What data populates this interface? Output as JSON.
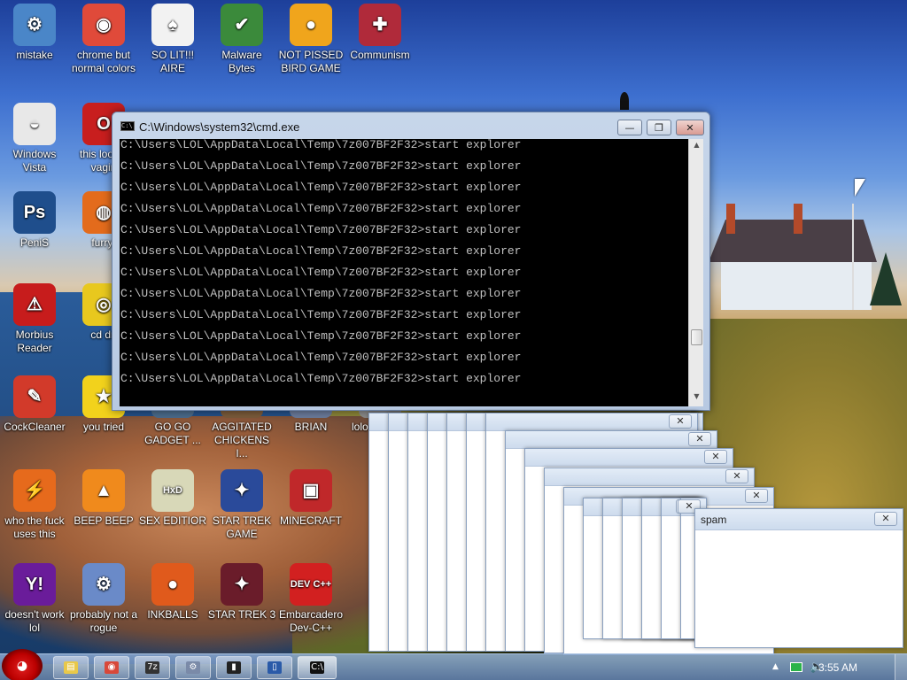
{
  "desktop": {
    "icons": [
      {
        "label": "mistake",
        "glyph": "⚙",
        "color": "#4a86c8"
      },
      {
        "label": "chrome but normal colors",
        "glyph": "◉",
        "color": "#e04a3a"
      },
      {
        "label": "SO LIT!!! AIRE",
        "glyph": "♠",
        "color": "#f2f2f2"
      },
      {
        "label": "Malware Bytes",
        "glyph": "✔",
        "color": "#3b8a3b"
      },
      {
        "label": "NOT PISSED BIRD GAME",
        "glyph": "●",
        "color": "#f0a51c"
      },
      {
        "label": "Communism",
        "glyph": "✚",
        "color": "#b02a3a"
      },
      {
        "label": "Windows Vista",
        "glyph": "◒",
        "color": "#e8e8e8"
      },
      {
        "label": "this look a vagin",
        "glyph": "O",
        "color": "#c81e1e"
      },
      {
        "label": "PeniS",
        "glyph": "Ps",
        "color": "#1f4e8c"
      },
      {
        "label": "furryf",
        "glyph": "◍",
        "color": "#e36b1c"
      },
      {
        "label": "Morbius Reader",
        "glyph": "⚠",
        "color": "#c71c1c"
      },
      {
        "label": "cd dri",
        "glyph": "◎",
        "color": "#e8c81e"
      },
      {
        "label": "CockCleaner",
        "glyph": "✎",
        "color": "#d23a2a"
      },
      {
        "label": "you tried",
        "glyph": "★",
        "color": "#f2d21c"
      },
      {
        "label": "GO GO GADGET ...",
        "glyph": "",
        "color": "#4a6a8a"
      },
      {
        "label": "AGGITATED CHICKENS I...",
        "glyph": "",
        "color": "#7a5a3a"
      },
      {
        "label": "BRIAN",
        "glyph": "",
        "color": "#6a7a9a"
      },
      {
        "label": "lolo Copy (2",
        "glyph": "",
        "color": "#8a8a8a"
      },
      {
        "label": "who the fuck uses this",
        "glyph": "⚡",
        "color": "#e66a1c"
      },
      {
        "label": "BEEP BEEP",
        "glyph": "▲",
        "color": "#f08a1c"
      },
      {
        "label": "SEX EDITIOR",
        "glyph": "HxD",
        "color": "#d8d8b8"
      },
      {
        "label": "STAR TREK GAME",
        "glyph": "✦",
        "color": "#2a4a9a"
      },
      {
        "label": "MINECRAFT",
        "glyph": "▣",
        "color": "#c0282a"
      },
      {
        "label": "doesn't work lol",
        "glyph": "Y!",
        "color": "#6a1c9a"
      },
      {
        "label": "probably not a rogue",
        "glyph": "⚙",
        "color": "#6a8ac8"
      },
      {
        "label": "INKBALLS",
        "glyph": "●",
        "color": "#e05a1c"
      },
      {
        "label": "STAR TREK 3",
        "glyph": "✦",
        "color": "#6a1c2a"
      },
      {
        "label": "Embarcadero Dev-C++",
        "glyph": "DEV C++",
        "color": "#d22020"
      }
    ]
  },
  "cmd": {
    "title": "C:\\Windows\\system32\\cmd.exe",
    "icon_label": "C:\\",
    "buttons": {
      "minimize": "—",
      "maximize": "❐",
      "close": "✕"
    },
    "lines": [
      "C:\\Users\\LOL\\AppData\\Local\\Temp\\7z007BF2F32>start explorer",
      "C:\\Users\\LOL\\AppData\\Local\\Temp\\7z007BF2F32>start explorer",
      "C:\\Users\\LOL\\AppData\\Local\\Temp\\7z007BF2F32>start explorer",
      "C:\\Users\\LOL\\AppData\\Local\\Temp\\7z007BF2F32>start explorer",
      "C:\\Users\\LOL\\AppData\\Local\\Temp\\7z007BF2F32>start explorer",
      "C:\\Users\\LOL\\AppData\\Local\\Temp\\7z007BF2F32>start explorer",
      "C:\\Users\\LOL\\AppData\\Local\\Temp\\7z007BF2F32>start explorer",
      "C:\\Users\\LOL\\AppData\\Local\\Temp\\7z007BF2F32>start explorer",
      "C:\\Users\\LOL\\AppData\\Local\\Temp\\7z007BF2F32>start explorer",
      "C:\\Users\\LOL\\AppData\\Local\\Temp\\7z007BF2F32>start explorer",
      "C:\\Users\\LOL\\AppData\\Local\\Temp\\7z007BF2F32>start explorer",
      "C:\\Users\\LOL\\AppData\\Local\\Temp\\7z007BF2F32>start explorer"
    ],
    "scroll_up": "▲",
    "scroll_down": "▼"
  },
  "spam_window": {
    "title": "spam",
    "close": "✕"
  },
  "taskbar": {
    "start_label": "◕",
    "buttons": [
      {
        "name": "taskbar-explorer",
        "glyph": "▤",
        "color": "#e8c84a"
      },
      {
        "name": "taskbar-chrome",
        "glyph": "◉",
        "color": "#d8483a"
      },
      {
        "name": "taskbar-7zip",
        "glyph": "7z",
        "color": "#333333"
      },
      {
        "name": "taskbar-tools",
        "glyph": "⚙",
        "color": "#7a8aa8"
      },
      {
        "name": "taskbar-terminal",
        "glyph": "▮",
        "color": "#222222"
      },
      {
        "name": "taskbar-phone",
        "glyph": "▯",
        "color": "#2a5aa8"
      },
      {
        "name": "taskbar-cmd-active",
        "glyph": "C:\\",
        "color": "#111111"
      }
    ],
    "tray": {
      "arrow": "▲",
      "clock": "3:55 AM"
    }
  }
}
